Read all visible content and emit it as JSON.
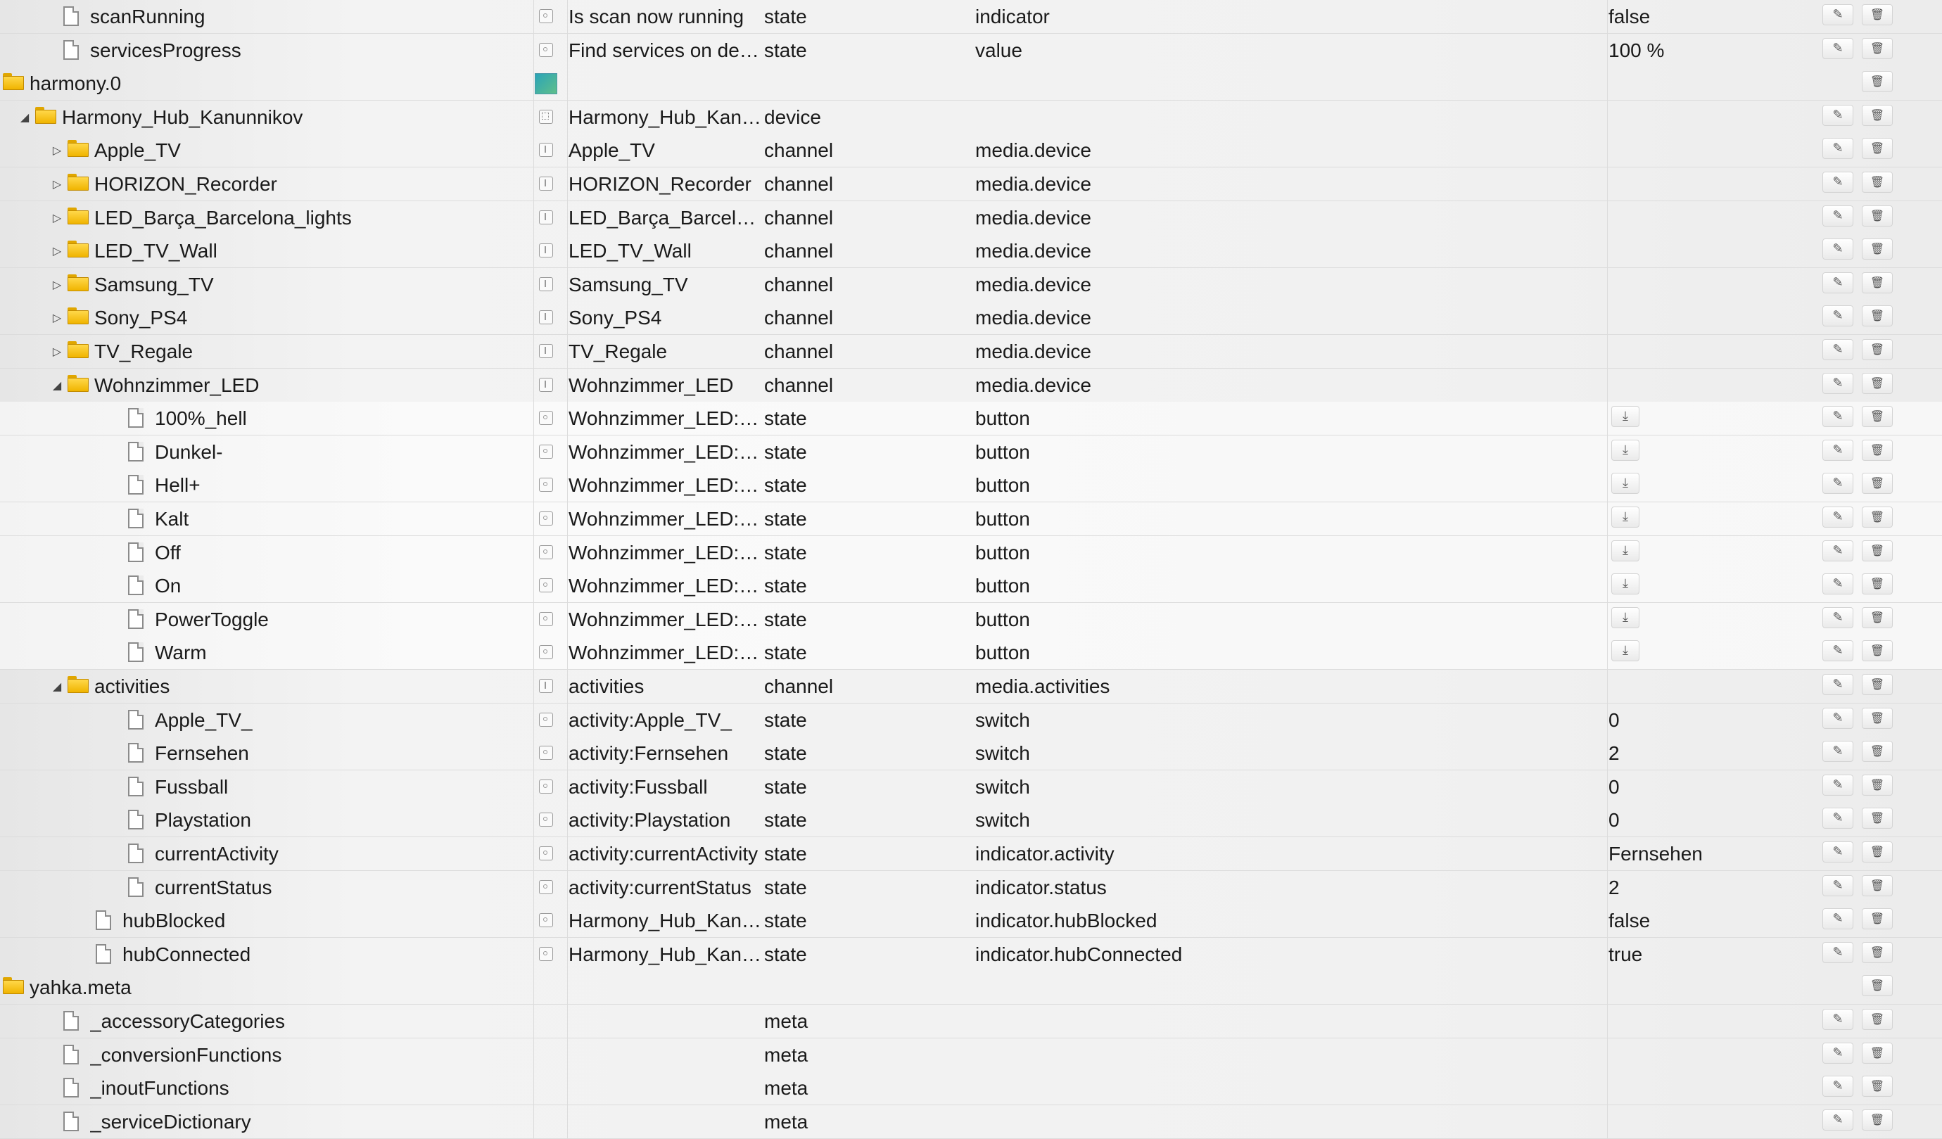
{
  "rows": [
    {
      "name": "scanRunning",
      "kind": "file",
      "level": 1,
      "oname": "Is scan now running",
      "type": "state",
      "role": "indicator",
      "value": "false",
      "icon": "state",
      "edit": true,
      "del": true
    },
    {
      "name": "servicesProgress",
      "kind": "file",
      "level": 1,
      "oname": "Find services on de…",
      "type": "state",
      "role": "value",
      "value": "100 %",
      "icon": "state",
      "edit": true,
      "del": true
    },
    {
      "name": "harmony.0",
      "kind": "folder",
      "level": 0,
      "oname": "",
      "type": "",
      "role": "",
      "value": "",
      "icon": "img",
      "edit": false,
      "del": true
    },
    {
      "name": "Harmony_Hub_Kanunnikov",
      "kind": "folder",
      "level": 1,
      "toggle": "open",
      "oname": "Harmony_Hub_Kan…",
      "type": "device",
      "role": "",
      "value": "",
      "icon": "dev",
      "edit": true,
      "del": true
    },
    {
      "name": "Apple_TV",
      "kind": "folder",
      "level": 2,
      "toggle": "closed",
      "oname": "Apple_TV",
      "type": "channel",
      "role": "media.device",
      "value": "",
      "icon": "ch",
      "edit": true,
      "del": true
    },
    {
      "name": "HORIZON_Recorder",
      "kind": "folder",
      "level": 2,
      "toggle": "closed",
      "oname": "HORIZON_Recorder",
      "type": "channel",
      "role": "media.device",
      "value": "",
      "icon": "ch",
      "edit": true,
      "del": true
    },
    {
      "name": "LED_Barça_Barcelona_lights",
      "kind": "folder",
      "level": 2,
      "toggle": "closed",
      "oname": "LED_Barça_Barcel…",
      "type": "channel",
      "role": "media.device",
      "value": "",
      "icon": "ch",
      "edit": true,
      "del": true
    },
    {
      "name": "LED_TV_Wall",
      "kind": "folder",
      "level": 2,
      "toggle": "closed",
      "oname": "LED_TV_Wall",
      "type": "channel",
      "role": "media.device",
      "value": "",
      "icon": "ch",
      "edit": true,
      "del": true
    },
    {
      "name": "Samsung_TV",
      "kind": "folder",
      "level": 2,
      "toggle": "closed",
      "oname": "Samsung_TV",
      "type": "channel",
      "role": "media.device",
      "value": "",
      "icon": "ch",
      "edit": true,
      "del": true
    },
    {
      "name": "Sony_PS4",
      "kind": "folder",
      "level": 2,
      "toggle": "closed",
      "oname": "Sony_PS4",
      "type": "channel",
      "role": "media.device",
      "value": "",
      "icon": "ch",
      "edit": true,
      "del": true
    },
    {
      "name": "TV_Regale",
      "kind": "folder",
      "level": 2,
      "toggle": "closed",
      "oname": "TV_Regale",
      "type": "channel",
      "role": "media.device",
      "value": "",
      "icon": "ch",
      "edit": true,
      "del": true
    },
    {
      "name": "Wohnzimmer_LED",
      "kind": "folder",
      "level": 2,
      "toggle": "open",
      "oname": "Wohnzimmer_LED",
      "type": "channel",
      "role": "media.device",
      "value": "",
      "icon": "ch",
      "edit": true,
      "del": true
    },
    {
      "name": "100%_hell",
      "kind": "file",
      "level": 3,
      "oname": "Wohnzimmer_LED:…",
      "type": "state",
      "role": "button",
      "value": "",
      "icon": "state",
      "push": true,
      "edit": true,
      "del": true,
      "hl": true
    },
    {
      "name": "Dunkel-",
      "kind": "file",
      "level": 3,
      "oname": "Wohnzimmer_LED:…",
      "type": "state",
      "role": "button",
      "value": "",
      "icon": "state",
      "push": true,
      "edit": true,
      "del": true,
      "hl": true
    },
    {
      "name": "Hell+",
      "kind": "file",
      "level": 3,
      "oname": "Wohnzimmer_LED:…",
      "type": "state",
      "role": "button",
      "value": "",
      "icon": "state",
      "push": true,
      "edit": true,
      "del": true,
      "hl": true
    },
    {
      "name": "Kalt",
      "kind": "file",
      "level": 3,
      "oname": "Wohnzimmer_LED:…",
      "type": "state",
      "role": "button",
      "value": "",
      "icon": "state",
      "push": true,
      "edit": true,
      "del": true,
      "hl": true
    },
    {
      "name": "Off",
      "kind": "file",
      "level": 3,
      "oname": "Wohnzimmer_LED:…",
      "type": "state",
      "role": "button",
      "value": "",
      "icon": "state",
      "push": true,
      "edit": true,
      "del": true,
      "hl": true
    },
    {
      "name": "On",
      "kind": "file",
      "level": 3,
      "oname": "Wohnzimmer_LED:…",
      "type": "state",
      "role": "button",
      "value": "",
      "icon": "state",
      "push": true,
      "edit": true,
      "del": true,
      "hl": true
    },
    {
      "name": "PowerToggle",
      "kind": "file",
      "level": 3,
      "oname": "Wohnzimmer_LED:…",
      "type": "state",
      "role": "button",
      "value": "",
      "icon": "state",
      "push": true,
      "edit": true,
      "del": true,
      "hl": true
    },
    {
      "name": "Warm",
      "kind": "file",
      "level": 3,
      "oname": "Wohnzimmer_LED:…",
      "type": "state",
      "role": "button",
      "value": "",
      "icon": "state",
      "push": true,
      "edit": true,
      "del": true,
      "hl": true
    },
    {
      "name": "activities",
      "kind": "folder",
      "level": 2,
      "toggle": "open",
      "oname": "activities",
      "type": "channel",
      "role": "media.activities",
      "value": "",
      "icon": "ch",
      "edit": true,
      "del": true
    },
    {
      "name": "Apple_TV_",
      "kind": "file",
      "level": 3,
      "oname": "activity:Apple_TV_",
      "type": "state",
      "role": "switch",
      "value": "0",
      "icon": "state",
      "edit": true,
      "del": true
    },
    {
      "name": "Fernsehen",
      "kind": "file",
      "level": 3,
      "oname": "activity:Fernsehen",
      "type": "state",
      "role": "switch",
      "value": "2",
      "icon": "state",
      "edit": true,
      "del": true
    },
    {
      "name": "Fussball",
      "kind": "file",
      "level": 3,
      "oname": "activity:Fussball",
      "type": "state",
      "role": "switch",
      "value": "0",
      "icon": "state",
      "edit": true,
      "del": true
    },
    {
      "name": "Playstation",
      "kind": "file",
      "level": 3,
      "oname": "activity:Playstation",
      "type": "state",
      "role": "switch",
      "value": "0",
      "icon": "state",
      "edit": true,
      "del": true
    },
    {
      "name": "currentActivity",
      "kind": "file",
      "level": 3,
      "oname": "activity:currentActivity",
      "type": "state",
      "role": "indicator.activity",
      "value": "Fernsehen",
      "icon": "state",
      "edit": true,
      "del": true
    },
    {
      "name": "currentStatus",
      "kind": "file",
      "level": 3,
      "oname": "activity:currentStatus",
      "type": "state",
      "role": "indicator.status",
      "value": "2",
      "icon": "state",
      "edit": true,
      "del": true
    },
    {
      "name": "hubBlocked",
      "kind": "file",
      "level": 2,
      "oname": "Harmony_Hub_Kan…",
      "type": "state",
      "role": "indicator.hubBlocked",
      "value": "false",
      "icon": "state",
      "edit": true,
      "del": true
    },
    {
      "name": "hubConnected",
      "kind": "file",
      "level": 2,
      "oname": "Harmony_Hub_Kan…",
      "type": "state",
      "role": "indicator.hubConnected",
      "value": "true",
      "icon": "state",
      "edit": true,
      "del": true
    },
    {
      "name": "yahka.meta",
      "kind": "folder",
      "level": 0,
      "oname": "",
      "type": "",
      "role": "",
      "value": "",
      "icon": "",
      "edit": false,
      "del": true
    },
    {
      "name": "_accessoryCategories",
      "kind": "file",
      "level": 1,
      "oname": "",
      "type": "meta",
      "role": "",
      "value": "",
      "icon": "",
      "edit": true,
      "del": true
    },
    {
      "name": "_conversionFunctions",
      "kind": "file",
      "level": 1,
      "oname": "",
      "type": "meta",
      "role": "",
      "value": "",
      "icon": "",
      "edit": true,
      "del": true
    },
    {
      "name": "_inoutFunctions",
      "kind": "file",
      "level": 1,
      "oname": "",
      "type": "meta",
      "role": "",
      "value": "",
      "icon": "",
      "edit": true,
      "del": true
    },
    {
      "name": "_serviceDictionary",
      "kind": "file",
      "level": 1,
      "oname": "",
      "type": "meta",
      "role": "",
      "value": "",
      "icon": "",
      "edit": true,
      "del": true
    }
  ],
  "icons": {
    "edit": "pencil-icon",
    "delete": "trash-icon",
    "push": "push-icon",
    "expand": "chevron-right-icon",
    "collapse": "chevron-down-icon"
  },
  "colors": {
    "folder": "#f0b400",
    "background": "#ebebeb",
    "border": "#dcdcdc"
  }
}
